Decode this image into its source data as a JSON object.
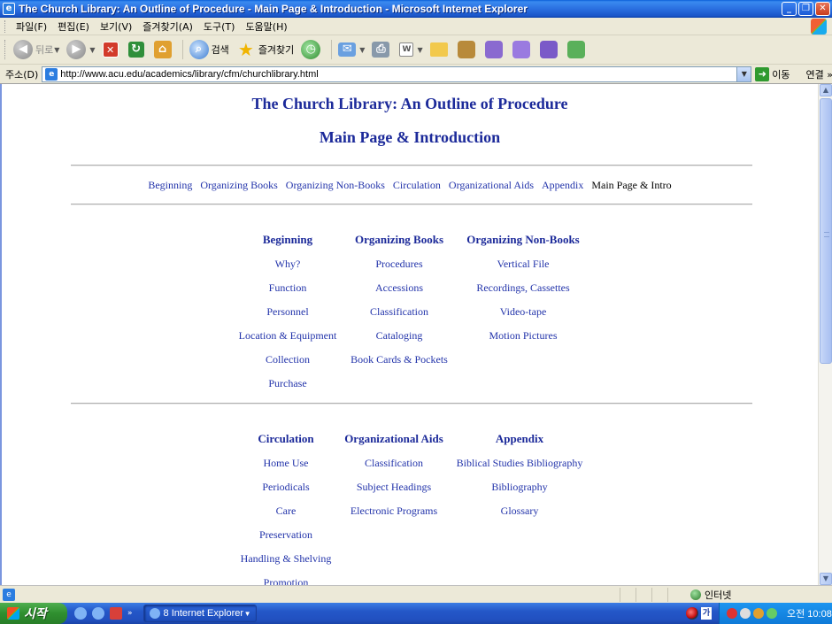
{
  "window": {
    "title": "The Church Library: An Outline of Procedure - Main Page & Introduction - Microsoft Internet Explorer"
  },
  "menu": [
    "파일(F)",
    "편집(E)",
    "보기(V)",
    "즐겨찾기(A)",
    "도구(T)",
    "도움말(H)"
  ],
  "toolbar": {
    "back_label": "뒤로",
    "search_label": "검색",
    "favorites_label": "즐겨찾기"
  },
  "address": {
    "label": "주소(D)",
    "url": "http://www.acu.edu/academics/library/cfm/churchlibrary.html",
    "go_label": "이동",
    "links_label": "연결 »"
  },
  "page": {
    "title": "The Church Library: An Outline of Procedure",
    "subtitle": "Main Page & Introduction",
    "nav": [
      "Beginning",
      "Organizing Books",
      "Organizing Non-Books",
      "Circulation",
      "Organizational Aids",
      "Appendix"
    ],
    "nav_current": "Main Page & Intro",
    "section1": {
      "beginning": {
        "heading": "Beginning",
        "items": [
          "Why?",
          "Function",
          "Personnel",
          "Location & Equipment",
          "Collection",
          "Purchase"
        ]
      },
      "organizing_books": {
        "heading": "Organizing Books",
        "items": [
          "Procedures",
          "Accessions",
          "Classification",
          "Cataloging",
          "Book Cards & Pockets"
        ]
      },
      "organizing_non_books": {
        "heading": "Organizing Non-Books",
        "items": [
          "Vertical File",
          "Recordings, Cassettes",
          "Video-tape",
          "Motion Pictures"
        ]
      }
    },
    "section2": {
      "circulation": {
        "heading": "Circulation",
        "items": [
          "Home Use",
          "Periodicals",
          "Care",
          "Preservation",
          "Handling & Shelving",
          "Promotion"
        ]
      },
      "organizational_aids": {
        "heading": "Organizational Aids",
        "items": [
          "Classification",
          "Subject Headings",
          "Electronic Programs"
        ]
      },
      "appendix": {
        "heading": "Appendix",
        "items": [
          "Biblical Studies Bibliography",
          "Bibliography",
          "Glossary"
        ]
      }
    }
  },
  "status": {
    "zone": "인터넷"
  },
  "taskbar": {
    "start": "시작",
    "task_label": "8 Internet Explorer",
    "clock": "오전 10:08",
    "lang": "가"
  }
}
